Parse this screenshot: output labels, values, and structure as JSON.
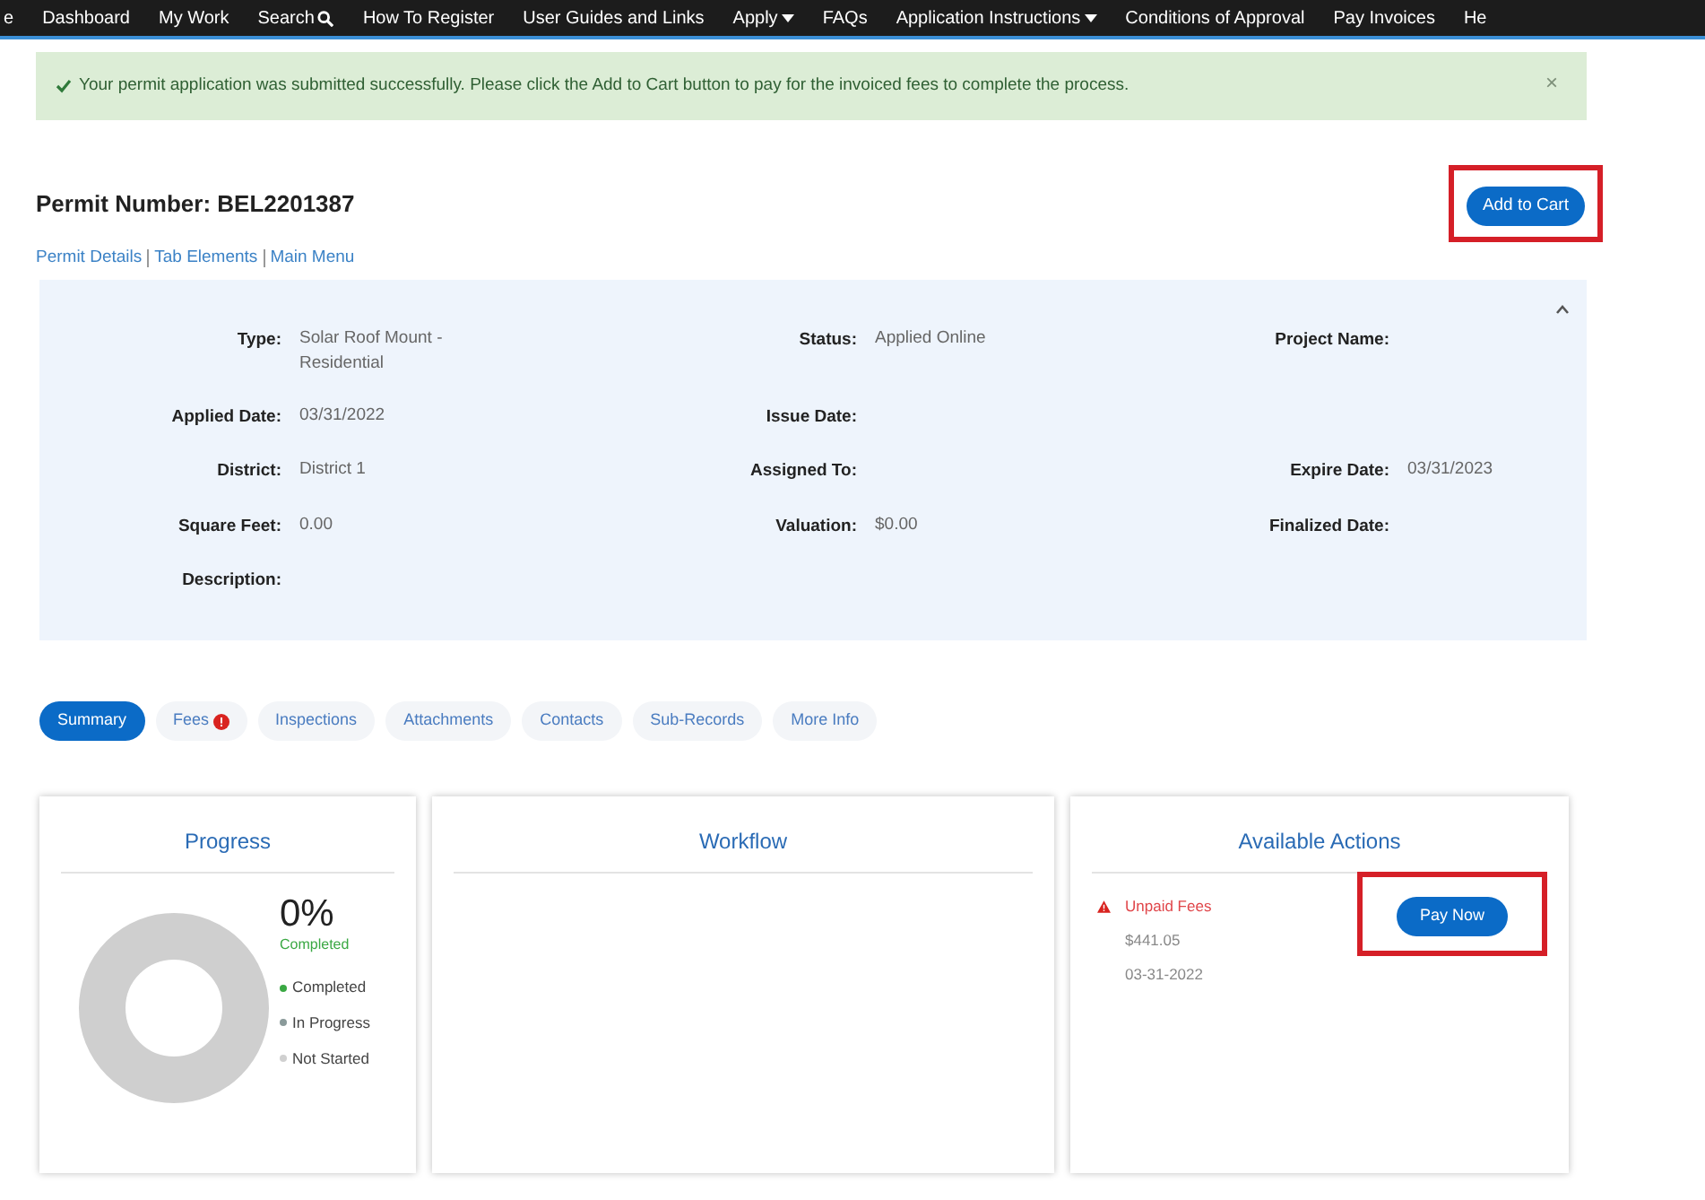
{
  "nav": {
    "items": [
      {
        "label": "e",
        "kind": "link"
      },
      {
        "label": "Dashboard",
        "kind": "link"
      },
      {
        "label": "My Work",
        "kind": "link"
      },
      {
        "label": "Search",
        "kind": "search"
      },
      {
        "label": "How To Register",
        "kind": "link"
      },
      {
        "label": "User Guides and Links",
        "kind": "link"
      },
      {
        "label": "Apply",
        "kind": "dropdown"
      },
      {
        "label": "FAQs",
        "kind": "link"
      },
      {
        "label": "Application Instructions",
        "kind": "dropdown"
      },
      {
        "label": "Conditions of Approval",
        "kind": "link"
      },
      {
        "label": "Pay Invoices",
        "kind": "link"
      },
      {
        "label": "He",
        "kind": "link"
      }
    ]
  },
  "alert": {
    "message": "Your permit application was submitted successfully. Please click the Add to Cart button to pay for the invoiced fees to complete the process.",
    "close": "×"
  },
  "permit": {
    "title": "Permit Number: BEL2201387",
    "add_to_cart": {
      "label": "Add to Cart",
      "highlighted": true
    }
  },
  "links": [
    "Permit Details",
    "Tab Elements",
    "Main Menu"
  ],
  "details": {
    "expanded": true,
    "rows": [
      [
        {
          "label": "Type:",
          "value": "Solar Roof Mount - Residential"
        },
        {
          "label": "Status:",
          "value": "Applied Online"
        },
        {
          "label": "Project Name:"
        }
      ],
      [
        {
          "label": "Applied Date:",
          "value": "03/31/2022"
        },
        {
          "label": "Issue Date:"
        }
      ],
      [
        {
          "label": "District:",
          "value": "District 1"
        },
        {
          "label": "Assigned To:"
        },
        {
          "label": "Expire Date:",
          "value": "03/31/2023"
        }
      ],
      [
        {
          "label": "Square Feet:",
          "value": "0.00"
        },
        {
          "label": "Valuation:",
          "value": "$0.00"
        },
        {
          "label": "Finalized Date:"
        }
      ],
      [
        {
          "label": "Description:"
        }
      ]
    ]
  },
  "tabs": [
    {
      "label": "Summary",
      "selected": true,
      "alert": false
    },
    {
      "label": "Fees",
      "selected": false,
      "alert": true
    },
    {
      "label": "Inspections",
      "selected": false,
      "alert": false
    },
    {
      "label": "Attachments",
      "selected": false,
      "alert": false
    },
    {
      "label": "Contacts",
      "selected": false,
      "alert": false
    },
    {
      "label": "Sub-Records",
      "selected": false,
      "alert": false
    },
    {
      "label": "More Info",
      "selected": false,
      "alert": false
    }
  ],
  "progress": {
    "title": "Progress",
    "percent": "0%",
    "caption": "Completed",
    "legend": [
      {
        "label": "Completed",
        "color": "#3aa843"
      },
      {
        "label": "In Progress",
        "color": "#8a9a9a"
      },
      {
        "label": "Not Started",
        "color": "#d0d0d0"
      }
    ]
  },
  "workflow": {
    "title": "Workflow"
  },
  "actions": {
    "title": "Available Actions",
    "items": [
      {
        "title": "Unpaid Fees",
        "amount": "$441.05",
        "date": "03-31-2022",
        "button": {
          "label": "Pay Now",
          "highlighted": true
        }
      }
    ]
  }
}
